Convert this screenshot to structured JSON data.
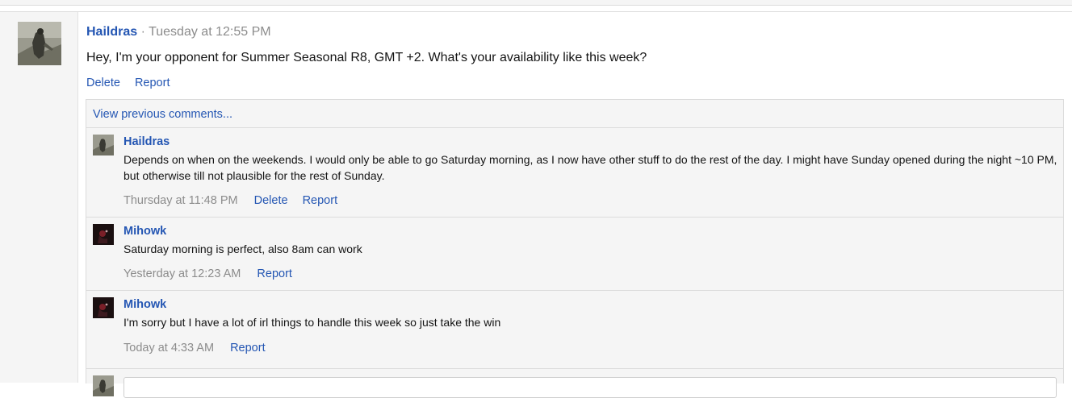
{
  "post": {
    "author": "Haildras",
    "separator": "·",
    "time": "Tuesday at 12:55 PM",
    "message": "Hey, I'm your opponent for Summer Seasonal R8, GMT +2. What's your availability like this week?",
    "actions": {
      "delete": "Delete",
      "report": "Report"
    }
  },
  "comments": {
    "view_previous": "View previous comments...",
    "items": [
      {
        "author": "Haildras",
        "text": "Depends on when on the weekends. I would only be able to go Saturday morning, as I now have other stuff to do the rest of the day. I might have Sunday opened during the night ~10 PM, but otherwise till not plausible for the rest of Sunday.",
        "time": "Thursday at 11:48 PM",
        "delete": "Delete",
        "report": "Report"
      },
      {
        "author": "Mihowk",
        "text": "Saturday morning is perfect, also 8am can work",
        "time": "Yesterday at 12:23 AM",
        "report": "Report"
      },
      {
        "author": "Mihowk",
        "text": "I'm sorry but I have a lot of irl things to handle this week so just take the win",
        "time": "Today at 4:33 AM",
        "report": "Report"
      }
    ]
  },
  "colors": {
    "link": "#2456b3",
    "muted": "#8c8c8c",
    "panel": "#f5f5f5",
    "border": "#dcdcdc"
  }
}
